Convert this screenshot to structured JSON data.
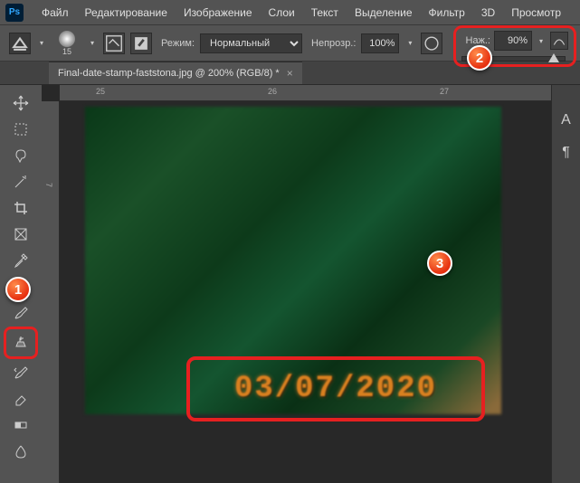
{
  "menu": {
    "items": [
      "Файл",
      "Редактирование",
      "Изображение",
      "Слои",
      "Текст",
      "Выделение",
      "Фильтр",
      "3D",
      "Просмотр"
    ],
    "logo": "Ps"
  },
  "options": {
    "brush_size": "15",
    "mode_label": "Режим:",
    "mode_value": "Нормальный",
    "opacity_label": "Непрозр.:",
    "opacity_value": "100%",
    "flow_label": "Наж.:",
    "flow_value": "90%"
  },
  "tab": {
    "title": "Final-date-stamp-faststona.jpg @ 200% (RGB/8) *"
  },
  "ruler": {
    "h": [
      "25",
      "26",
      "27"
    ],
    "v": [
      "7"
    ]
  },
  "canvas": {
    "date_stamp": "03/07/2020"
  },
  "annotations": {
    "n1": "1",
    "n2": "2",
    "n3": "3"
  },
  "right_panel": {
    "i1": "A",
    "i2": "¶"
  }
}
